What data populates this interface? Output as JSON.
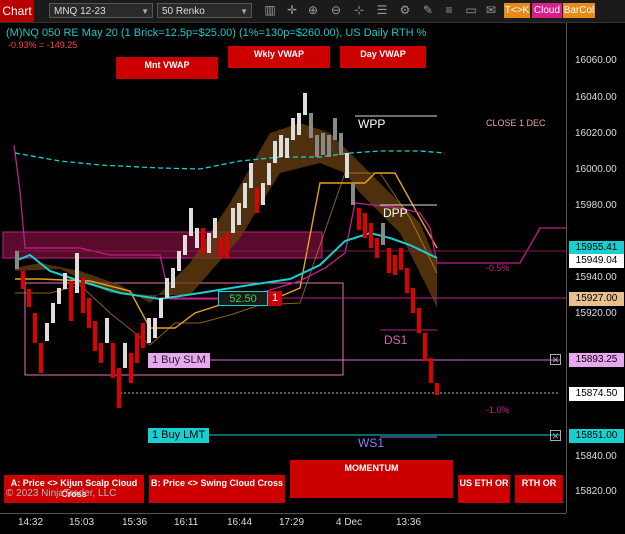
{
  "toolbar": {
    "chart_tab": "Chart",
    "instrument": "MNQ 12-23",
    "interval": "50 Renko",
    "tk_label": "T<>K",
    "cloud_label": "Cloud",
    "barcol_label": "BarCol"
  },
  "header": {
    "title": "(M)NQ 050 RE May 20 (1 Brick=12.5p=$25.00) (1%=130p=$260.00), US Daily RTH %",
    "pnl": "-0.93% = -149.25"
  },
  "vwap_buttons": {
    "monthly": "Mnt VWAP",
    "weekly": "Wkly VWAP",
    "daily": "Day VWAP"
  },
  "levels": {
    "wpp": "WPP",
    "dpp": "DPP",
    "ds1": "DS1",
    "ws1": "WS1",
    "close": "CLOSE 1 DEC",
    "pct_neg05": "-0.5%",
    "pct_neg10": "-1.0%"
  },
  "position": {
    "pnl": "52.50",
    "qty": "1"
  },
  "orders": {
    "slm": "1 Buy SLM",
    "lmt": "1 Buy LMT"
  },
  "bottom_buttons": {
    "a": "A: Price <> Kijun Scalp Cloud Cross",
    "b": "B: Price <> Swing Cloud Cross",
    "momentum": "MOMENTUM",
    "us_eth_or": "US ETH OR",
    "rth_or": "RTH OR"
  },
  "copyright": "© 2023 NinjaTrader, LLC",
  "price_axis": {
    "ticks": [
      "16060.00",
      "16040.00",
      "16020.00",
      "16000.00",
      "15980.00",
      "15940.00",
      "15920.00",
      "15840.00",
      "15820.00"
    ],
    "tags": {
      "p15955": "15955.41",
      "p15949": "15949.04",
      "p15927": "15927.00",
      "p15893": "15893.25",
      "p15874": "15874.50",
      "p15851": "15851.00"
    }
  },
  "time_axis": {
    "ticks": [
      "14:32",
      "15:03",
      "15:36",
      "16:11",
      "16:44",
      "17:29",
      "4 Dec",
      "13:36"
    ]
  },
  "colors": {
    "up_brick": "#ffffff",
    "down_brick": "#e00000",
    "kijun": "#19d0d0",
    "cloud": "#e8a020",
    "vwap": "#c0208a"
  }
}
